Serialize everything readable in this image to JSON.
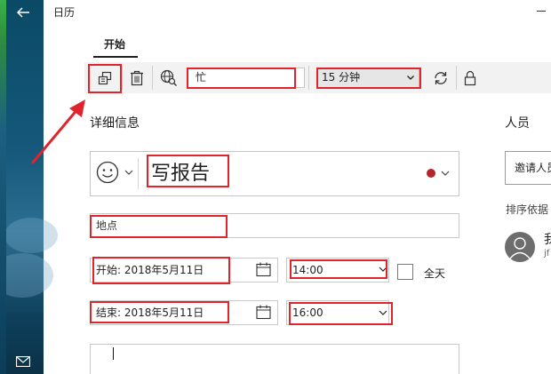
{
  "app": {
    "title": "日历"
  },
  "ribbon": {
    "tab": "开始"
  },
  "toolbar": {
    "show_as_value": "忙",
    "reminder_value": "15 分钟"
  },
  "details": {
    "heading": "详细信息",
    "subject": "写报告",
    "location_placeholder": "地点",
    "start_date": "开始: 2018年5月11日",
    "start_time": "14:00",
    "all_day_label": "全天",
    "end_date": "结束: 2018年5月11日",
    "end_time": "16:00"
  },
  "people": {
    "heading": "人员",
    "invite_placeholder": "邀请人员",
    "sort_label": "排序依据",
    "person_name": "我",
    "person_sub": "jf"
  },
  "colors": {
    "annotation_red": "#e0242c",
    "calendar_dot": "#b3262a"
  }
}
